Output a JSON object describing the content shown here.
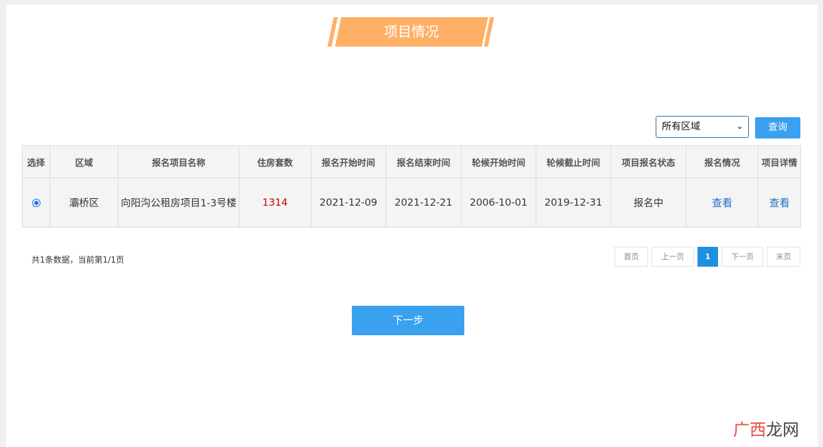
{
  "page": {
    "title": "项目情况"
  },
  "search": {
    "region_value": "所有区域",
    "query_label": "查询"
  },
  "table": {
    "headers": [
      "选择",
      "区域",
      "报名项目名称",
      "住房套数",
      "报名开始时间",
      "报名结束时间",
      "轮候开始时间",
      "轮候截止时间",
      "项目报名状态",
      "报名情况",
      "项目详情"
    ],
    "rows": [
      {
        "selected": true,
        "district": "灞桥区",
        "project_name": "向阳沟公租房项目1-3号楼",
        "units": "1314",
        "signup_start": "2021-12-09",
        "signup_end": "2021-12-21",
        "queue_start": "2006-10-01",
        "queue_end": "2019-12-31",
        "status": "报名中",
        "signup_link": "查看",
        "detail_link": "查看"
      }
    ]
  },
  "footer": {
    "summary": "共1条数据，当前第1/1页",
    "pager": {
      "first": "首页",
      "prev": "上一页",
      "current": "1",
      "next": "下一页",
      "last": "末页"
    },
    "next_step": "下一步"
  },
  "watermark": {
    "part1": "广西",
    "part2": "龙网"
  },
  "colors": {
    "banner": "#ffb066",
    "accent": "#3aa0f0",
    "count": "#c00000",
    "link": "#1f6fbf",
    "pager_active": "#1e90e0"
  }
}
